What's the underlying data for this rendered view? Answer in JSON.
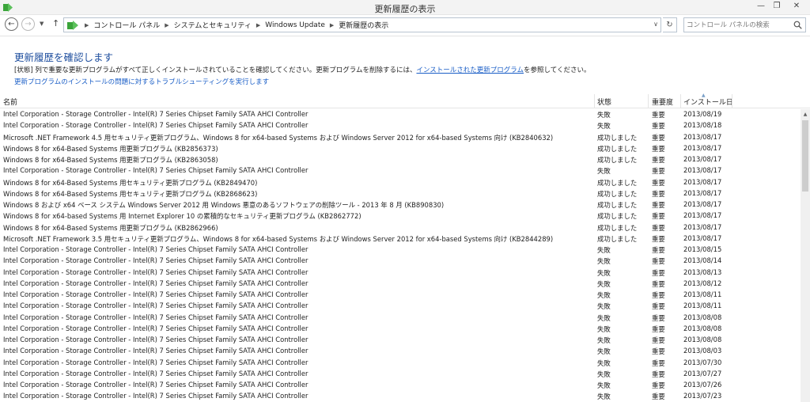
{
  "window": {
    "title": "更新履歴の表示",
    "minimize_glyph": "—",
    "maximize_glyph": "❐",
    "close_glyph": "✕"
  },
  "nav": {
    "back_icon": "back-arrow-icon",
    "forward_icon": "forward-arrow-icon",
    "up_icon": "up-arrow-icon",
    "breadcrumbs": [
      "コントロール パネル",
      "システムとセキュリティ",
      "Windows Update",
      "更新履歴の表示"
    ],
    "search_placeholder": "コントロール パネルの検索"
  },
  "page": {
    "title": "更新履歴を確認します",
    "desc_before": "[状態] 列で重要な更新プログラムがすべて正しくインストールされていることを確認してください。更新プログラムを削除するには、",
    "desc_link": "インストールされた更新プログラム",
    "desc_after": "を参照してください。",
    "trouble_link": "更新プログラムのインストールの問題に対するトラブルシューティングを実行します"
  },
  "table": {
    "headers": {
      "name": "名前",
      "status": "状態",
      "importance": "重要度",
      "date": "インストール日"
    },
    "rows": [
      {
        "name": "Intel Corporation - Storage Controller - Intel(R) 7 Series Chipset Family SATA AHCI Controller",
        "status": "失敗",
        "importance": "重要",
        "date": "2013/08/19"
      },
      {
        "name": "Intel Corporation - Storage Controller - Intel(R) 7 Series Chipset Family SATA AHCI Controller",
        "status": "失敗",
        "importance": "重要",
        "date": "2013/08/18"
      },
      {
        "name": "Microsoft .NET Framework 4.5 用セキュリティ更新プログラム、Windows 8 for x64-based Systems および Windows Server 2012 for x64-based Systems 向け (KB2840632)",
        "status": "成功しました",
        "importance": "重要",
        "date": "2013/08/17"
      },
      {
        "name": "Windows 8 for x64-Based Systems 用更新プログラム (KB2856373)",
        "status": "成功しました",
        "importance": "重要",
        "date": "2013/08/17"
      },
      {
        "name": "Windows 8 for x64-Based Systems 用更新プログラム (KB2863058)",
        "status": "成功しました",
        "importance": "重要",
        "date": "2013/08/17"
      },
      {
        "name": "Intel Corporation - Storage Controller - Intel(R) 7 Series Chipset Family SATA AHCI Controller",
        "status": "失敗",
        "importance": "重要",
        "date": "2013/08/17"
      },
      {
        "name": "Windows 8 for x64-Based Systems 用セキュリティ更新プログラム (KB2849470)",
        "status": "成功しました",
        "importance": "重要",
        "date": "2013/08/17"
      },
      {
        "name": "Windows 8 for x64-Based Systems 用セキュリティ更新プログラム (KB2868623)",
        "status": "成功しました",
        "importance": "重要",
        "date": "2013/08/17"
      },
      {
        "name": "Windows 8 および x64 ベース システム Windows Server 2012 用 Windows 悪意のあるソフトウェアの削除ツール - 2013 年 8 月 (KB890830)",
        "status": "成功しました",
        "importance": "重要",
        "date": "2013/08/17"
      },
      {
        "name": "Windows 8 for x64-based Systems 用 Internet Explorer 10 の累積的なセキュリティ更新プログラム (KB2862772)",
        "status": "成功しました",
        "importance": "重要",
        "date": "2013/08/17"
      },
      {
        "name": "Windows 8 for x64-Based Systems 用更新プログラム (KB2862966)",
        "status": "成功しました",
        "importance": "重要",
        "date": "2013/08/17"
      },
      {
        "name": "Microsoft .NET Framework 3.5 用セキュリティ更新プログラム、Windows 8 for x64-based Systems および Windows Server 2012 for x64-based Systems 向け (KB2844289)",
        "status": "成功しました",
        "importance": "重要",
        "date": "2013/08/17"
      },
      {
        "name": "Intel Corporation - Storage Controller - Intel(R) 7 Series Chipset Family SATA AHCI Controller",
        "status": "失敗",
        "importance": "重要",
        "date": "2013/08/15"
      },
      {
        "name": "Intel Corporation - Storage Controller - Intel(R) 7 Series Chipset Family SATA AHCI Controller",
        "status": "失敗",
        "importance": "重要",
        "date": "2013/08/14"
      },
      {
        "name": "Intel Corporation - Storage Controller - Intel(R) 7 Series Chipset Family SATA AHCI Controller",
        "status": "失敗",
        "importance": "重要",
        "date": "2013/08/13"
      },
      {
        "name": "Intel Corporation - Storage Controller - Intel(R) 7 Series Chipset Family SATA AHCI Controller",
        "status": "失敗",
        "importance": "重要",
        "date": "2013/08/12"
      },
      {
        "name": "Intel Corporation - Storage Controller - Intel(R) 7 Series Chipset Family SATA AHCI Controller",
        "status": "失敗",
        "importance": "重要",
        "date": "2013/08/11"
      },
      {
        "name": "Intel Corporation - Storage Controller - Intel(R) 7 Series Chipset Family SATA AHCI Controller",
        "status": "失敗",
        "importance": "重要",
        "date": "2013/08/11"
      },
      {
        "name": "Intel Corporation - Storage Controller - Intel(R) 7 Series Chipset Family SATA AHCI Controller",
        "status": "失敗",
        "importance": "重要",
        "date": "2013/08/08"
      },
      {
        "name": "Intel Corporation - Storage Controller - Intel(R) 7 Series Chipset Family SATA AHCI Controller",
        "status": "失敗",
        "importance": "重要",
        "date": "2013/08/08"
      },
      {
        "name": "Intel Corporation - Storage Controller - Intel(R) 7 Series Chipset Family SATA AHCI Controller",
        "status": "失敗",
        "importance": "重要",
        "date": "2013/08/08"
      },
      {
        "name": "Intel Corporation - Storage Controller - Intel(R) 7 Series Chipset Family SATA AHCI Controller",
        "status": "失敗",
        "importance": "重要",
        "date": "2013/08/03"
      },
      {
        "name": "Intel Corporation - Storage Controller - Intel(R) 7 Series Chipset Family SATA AHCI Controller",
        "status": "失敗",
        "importance": "重要",
        "date": "2013/07/30"
      },
      {
        "name": "Intel Corporation - Storage Controller - Intel(R) 7 Series Chipset Family SATA AHCI Controller",
        "status": "失敗",
        "importance": "重要",
        "date": "2013/07/27"
      },
      {
        "name": "Intel Corporation - Storage Controller - Intel(R) 7 Series Chipset Family SATA AHCI Controller",
        "status": "失敗",
        "importance": "重要",
        "date": "2013/07/26"
      },
      {
        "name": "Intel Corporation - Storage Controller - Intel(R) 7 Series Chipset Family SATA AHCI Controller",
        "status": "失敗",
        "importance": "重要",
        "date": "2013/07/23"
      }
    ]
  },
  "colors": {
    "title_blue": "#1e4e9e",
    "link_blue": "#1a5ec7",
    "icon_green": "#3aa43a"
  }
}
